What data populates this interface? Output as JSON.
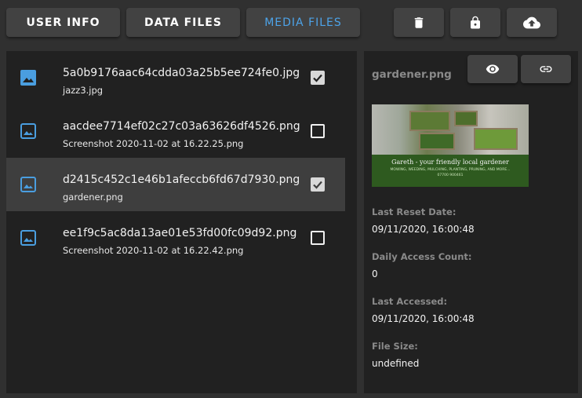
{
  "tabs": [
    {
      "label": "USER INFO",
      "active": false
    },
    {
      "label": "DATA FILES",
      "active": false
    },
    {
      "label": "MEDIA FILES",
      "active": true
    }
  ],
  "toolbar_icons": [
    "delete-icon",
    "lock-icon",
    "cloud-upload-icon"
  ],
  "files": [
    {
      "name": "5a0b9176aac64cdda03a25b5ee724fe0.jpg",
      "original": "jazz3.jpg",
      "checked": true,
      "selected": false,
      "icon": "image-icon"
    },
    {
      "name": "aacdee7714ef02c27c03a63626df4526.png",
      "original": "Screenshot 2020-11-02 at 16.22.25.png",
      "checked": false,
      "selected": false,
      "icon": "image-icon"
    },
    {
      "name": "d2415c452c1e46b1afeccb6fd67d7930.png",
      "original": "gardener.png",
      "checked": true,
      "selected": true,
      "icon": "image-icon"
    },
    {
      "name": "ee1f9c5ac8da13ae01e53fd00fc09d92.png",
      "original": "Screenshot 2020-11-02 at 16.22.42.png",
      "checked": false,
      "selected": false,
      "icon": "image-icon"
    }
  ],
  "detail": {
    "title": "gardener.png",
    "preview": {
      "headline": "Gareth - your friendly local gardener",
      "services": "MOWING, WEEDING, MULCHING, PLANTING, PRUNING, AND MORE...",
      "contact": "07700 900461"
    },
    "fields": [
      {
        "label": "Last Reset Date:",
        "value": "09/11/2020, 16:00:48"
      },
      {
        "label": "Daily Access Count:",
        "value": "0"
      },
      {
        "label": "Last Accessed:",
        "value": "09/11/2020, 16:00:48"
      },
      {
        "label": "File Size:",
        "value": "undefined"
      }
    ]
  },
  "colors": {
    "accent": "#4da3e8",
    "background": "#303030",
    "panel": "#212121",
    "button": "#424242",
    "selected_row": "#3e3e3e",
    "muted_text": "#8a8a8a",
    "file_icon": "#4a9ee0"
  }
}
